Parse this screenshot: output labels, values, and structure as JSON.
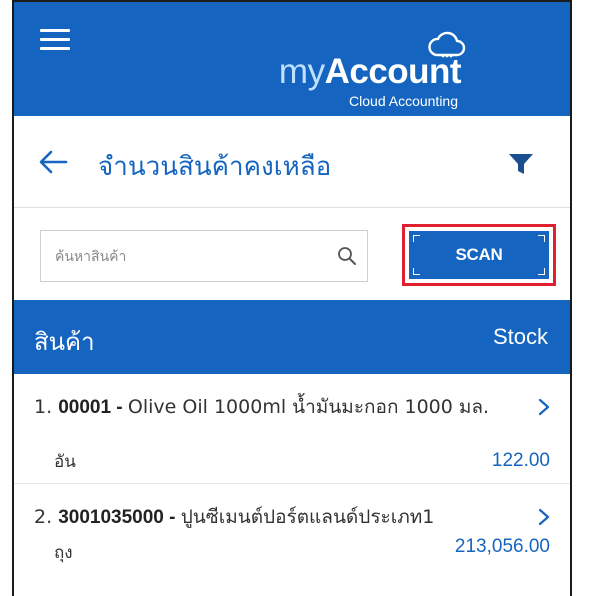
{
  "app": {
    "logo_prefix": "my",
    "logo_main": "Account",
    "logo_sub": "Cloud Accounting"
  },
  "page": {
    "title": "จำนวนสินค้าคงเหลือ"
  },
  "search": {
    "placeholder": "ค้นหาสินค้า",
    "value": ""
  },
  "scan_button": {
    "label": "SCAN"
  },
  "table": {
    "headers": {
      "product": "สินค้า",
      "stock": "Stock"
    },
    "rows": [
      {
        "index": "1.",
        "code": "00001",
        "separator": " - ",
        "name": "Olive Oil 1000ml น้ำมันมะกอก 1000 มล.",
        "unit": "อัน",
        "quantity": "122.00"
      },
      {
        "index": "2.",
        "code": "3001035000",
        "separator": " - ",
        "name": "ปูนซีเมนต์ปอร์ตแลนด์ประเภท1",
        "unit": "ถุง",
        "quantity": "213,056.00"
      }
    ]
  },
  "icons": {
    "menu": "hamburger-icon",
    "cloud": "cloud-icon",
    "back": "back-arrow-icon",
    "filter": "filter-icon",
    "search": "search-icon",
    "chevron": "chevron-right-icon"
  },
  "colors": {
    "primary": "#1565c0",
    "highlight": "#e0202e",
    "logo_accent": "#bfe0ff"
  }
}
